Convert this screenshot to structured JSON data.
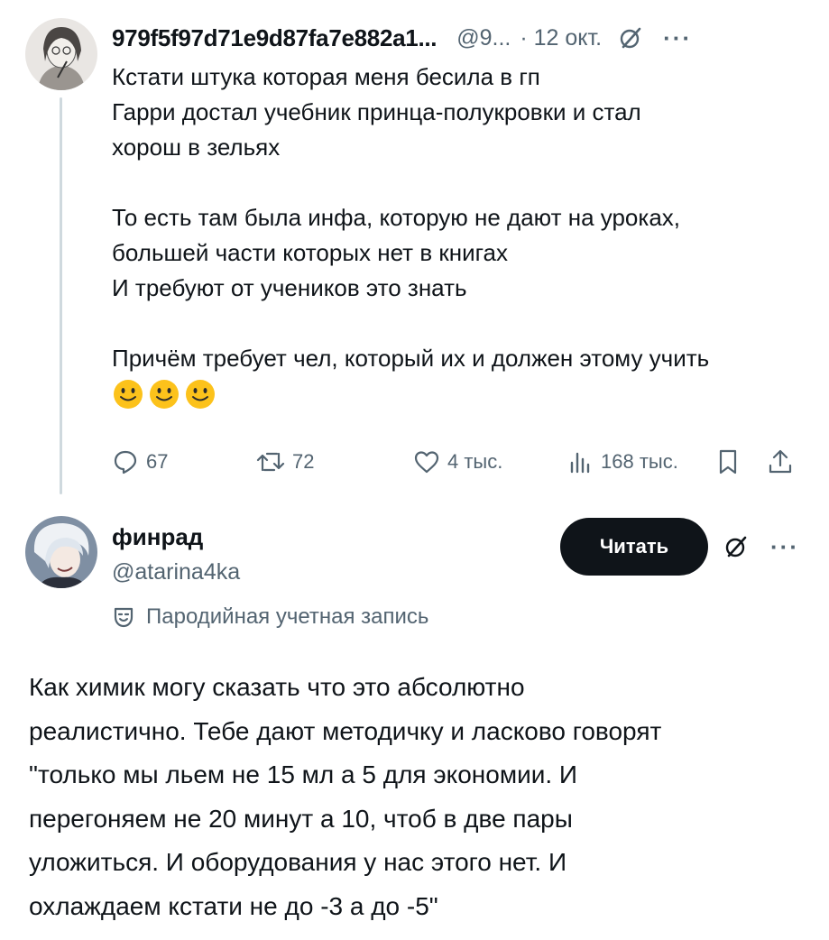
{
  "tweet1": {
    "author_name": "979f5f97d71e9d87fa7e882a1...",
    "handle": "@9...",
    "date": "· 12 окт.",
    "text_lines": [
      "Кстати штука которая меня бесила в гп",
      "Гарри достал учебник принца-полукровки и стал",
      "хорош в зельях",
      "То есть там была инфа, которую не дают на уроках,",
      "большей части которых нет в книгах",
      "И требуют от учеников это знать",
      "Причём требует чел, который их и должен этому учить"
    ],
    "emojis": [
      "slightly-smiling-face",
      "slightly-smiling-face",
      "slightly-smiling-face"
    ],
    "stats": {
      "replies": "67",
      "retweets": "72",
      "likes": "4 тыс.",
      "views": "168 тыс."
    }
  },
  "tweet2": {
    "author_name": "финрад",
    "handle": "@atarina4ka",
    "follow_label": "Читать",
    "parody_label": "Пародийная учетная запись",
    "text_lines": [
      "Как химик могу сказать что это абсолютно",
      "реалистично. Тебе дают методичку и ласково говорят",
      "\"только мы льем не 15 мл а 5 для экономии. И",
      "перегоняем не 20 минут а 10, чтоб в две пары",
      "уложиться. И оборудования у нас этого нет. И",
      "охлаждаем кстати не до -3 а до -5\""
    ]
  },
  "colors": {
    "text": "#0f1419",
    "secondary": "#536471",
    "thread_line": "#cfd9de",
    "button_bg": "#0f1419"
  },
  "icons": [
    "grok-icon",
    "more-icon",
    "reply-icon",
    "retweet-icon",
    "like-icon",
    "views-icon",
    "bookmark-icon",
    "share-icon",
    "parody-mask-icon"
  ]
}
